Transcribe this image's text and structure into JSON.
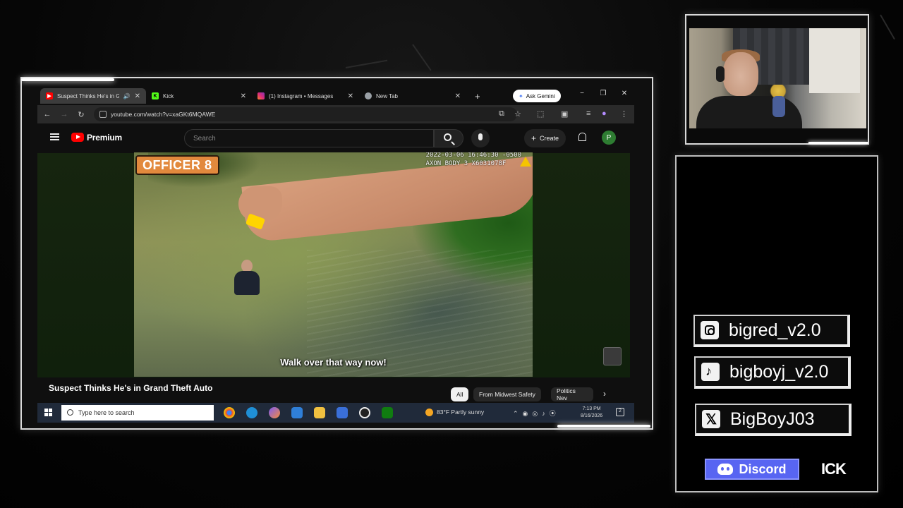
{
  "browser": {
    "tabs": [
      {
        "label": "Suspect Thinks He's in Gr",
        "favicon": "youtube-icon",
        "active": true
      },
      {
        "label": "Kick",
        "favicon": "kick-icon",
        "active": false
      },
      {
        "label": "(1) Instagram • Messages",
        "favicon": "instagram-icon",
        "active": false
      },
      {
        "label": "New Tab",
        "favicon": "chrome-icon",
        "active": false
      }
    ],
    "new_tab": "+",
    "gemini_label": "Ask Gemini",
    "url": "youtube.com/watch?v=xaGKt6MQAWE",
    "window_controls": [
      "−",
      "❐",
      "✕"
    ]
  },
  "youtube": {
    "brand": "Premium",
    "search_placeholder": "Search",
    "create_label": "Create",
    "avatar_letter": "P",
    "video": {
      "overlay_badge": "OFFICER 8",
      "camera_stamp_line1": "2022-03-06 16:46:30 -0500",
      "camera_stamp_line2": "AXON BODY 3 X6031078F",
      "subtitle": "Walk over that way now!"
    },
    "title": "Suspect Thinks He's in Grand Theft Auto",
    "chips": [
      "All",
      "From Midwest Safety",
      "Politics Nev"
    ]
  },
  "taskbar": {
    "search_placeholder": "Type here to search",
    "weather": "83°F  Partly sunny",
    "time": "7:13 PM",
    "date": "8/16/2026",
    "notification_count": "2"
  },
  "overlay": {
    "socials": [
      {
        "platform": "instagram",
        "icon": "instagram-icon",
        "handle": "bigred_v2.0"
      },
      {
        "platform": "tiktok",
        "icon": "tiktok-icon",
        "handle": "bigboyj_v2.0"
      },
      {
        "platform": "x",
        "icon": "x-icon",
        "handle": "BigBoyJ03"
      }
    ],
    "discord_label": "Discord",
    "kick_label": "ICK"
  }
}
